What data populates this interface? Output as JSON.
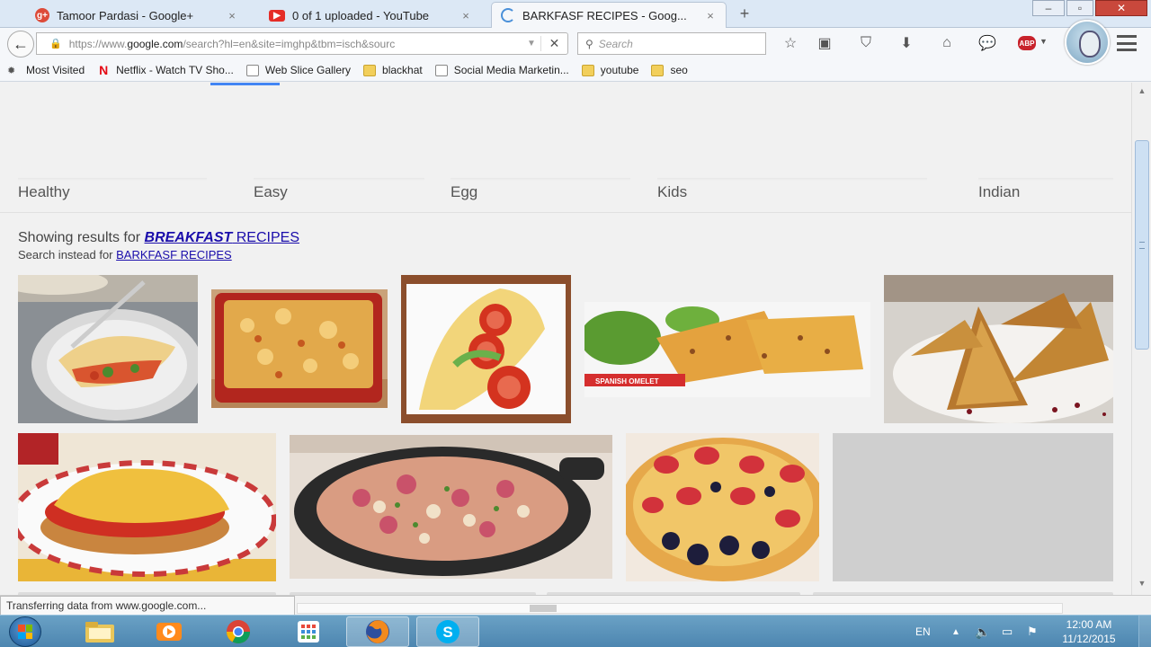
{
  "tabs": [
    {
      "title": "Tamoor Pardasi - Google+",
      "icon": "google-plus-icon"
    },
    {
      "title": "0 of 1 uploaded - YouTube",
      "icon": "youtube-icon"
    },
    {
      "title": "BARKFASF RECIPES - Goog...",
      "icon": "loading-icon",
      "active": true
    }
  ],
  "window": {
    "new_tab": "+",
    "close_tab": "×"
  },
  "nav": {
    "url_prefix": "https://www.",
    "url_domain": "google.com",
    "url_rest": "/search?hl=en&site=imghp&tbm=isch&sourc",
    "search_placeholder": "Search"
  },
  "bookmarks": [
    {
      "label": "Most Visited",
      "icon": "star-icon"
    },
    {
      "label": "Netflix - Watch TV Sho...",
      "icon": "netflix-icon"
    },
    {
      "label": "Web Slice Gallery",
      "icon": "page-icon"
    },
    {
      "label": "blackhat",
      "icon": "folder-icon"
    },
    {
      "label": "Social Media Marketin...",
      "icon": "page-icon"
    },
    {
      "label": "youtube",
      "icon": "folder-icon"
    },
    {
      "label": "seo",
      "icon": "folder-icon"
    }
  ],
  "chips": [
    "Healthy",
    "Easy",
    "Egg",
    "Kids",
    "Indian"
  ],
  "results": {
    "showing_prefix": "Showing results for ",
    "corrected_bold": "BREAKFAST",
    "corrected_rest": " RECIPES",
    "instead_prefix": "Search instead for ",
    "original_query": "BARKFASF RECIPES"
  },
  "images": [
    {
      "name": "omelette-plate-image"
    },
    {
      "name": "casserole-dish-image"
    },
    {
      "name": "omelette-tomato-image"
    },
    {
      "name": "spanish-omelet-image",
      "caption": "SPANISH OMELET"
    },
    {
      "name": "french-toast-image"
    },
    {
      "name": "egg-muffin-image"
    },
    {
      "name": "skillet-hash-image"
    },
    {
      "name": "berry-pancake-image"
    },
    {
      "name": "loading-placeholder-image"
    }
  ],
  "status": {
    "text": "Transferring data from www.google.com..."
  },
  "taskbar": {
    "lang": "EN",
    "time": "12:00 AM",
    "date": "11/12/2015"
  },
  "colors": {
    "link": "#1a0dab",
    "accent": "#4285f4",
    "taskbar": "#5a93bb"
  }
}
